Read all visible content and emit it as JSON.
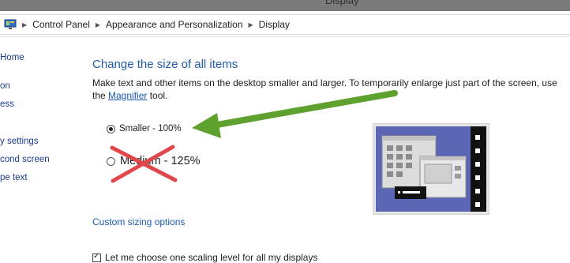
{
  "window": {
    "title": "Display"
  },
  "breadcrumb": {
    "items": [
      "Control Panel",
      "Appearance and Personalization",
      "Display"
    ]
  },
  "sidebar": {
    "items": [
      {
        "label": "Home"
      },
      {
        "label": "on"
      },
      {
        "label": "ess"
      },
      {
        "label": "y settings"
      },
      {
        "label": "cond screen"
      },
      {
        "label": "pe text"
      }
    ]
  },
  "main": {
    "title": "Change the size of all items",
    "description_before": "Make text and other items on the desktop smaller and larger. To temporarily enlarge just part of the screen, use the ",
    "magnifier_link": "Magnifier",
    "description_after": " tool.",
    "options": [
      {
        "label": "Smaller - 100%",
        "checked": true
      },
      {
        "label": "Medium - 125%",
        "checked": false
      }
    ],
    "custom_sizing_link": "Custom sizing options",
    "checkbox_label": "Let me choose one scaling level for all my displays",
    "checkbox_checked": true
  },
  "annotations": {
    "arrow_color": "#5fa12e",
    "cross_color": "#e0474c"
  },
  "colors": {
    "title_blue": "#1f5ba8",
    "link_blue": "#1a5bb0",
    "preview_bg": "#5b66b4"
  }
}
